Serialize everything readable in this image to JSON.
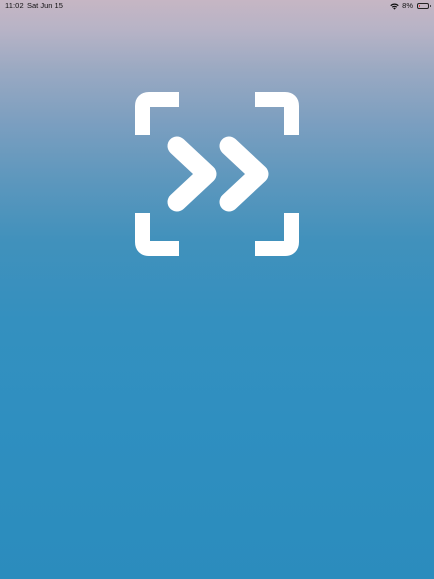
{
  "status_bar": {
    "time": "11:02",
    "date": "Sat Jun 15",
    "battery_percent": "8%",
    "battery_level": 0.08,
    "wifi_icon": "wifi-icon",
    "battery_icon": "battery-icon"
  },
  "splash": {
    "logo_icon": "fast-forward-scan-logo",
    "colors": {
      "logo": "#ffffff",
      "background_top": "#c6b6c4",
      "background_bottom": "#2b8cbd",
      "battery_low": "#e23b3b"
    }
  }
}
